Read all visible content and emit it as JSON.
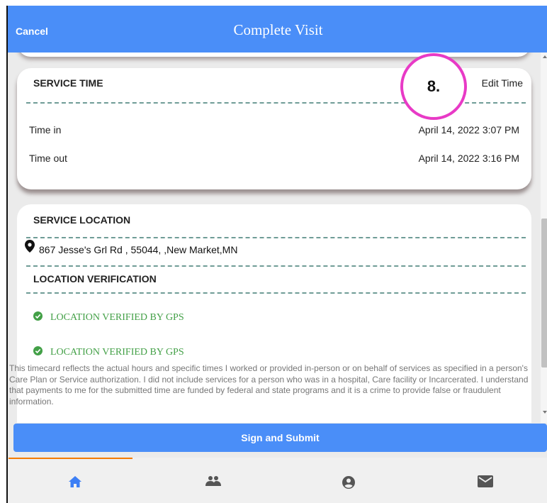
{
  "header": {
    "cancel_label": "Cancel",
    "title": "Complete Visit"
  },
  "service_time": {
    "title": "SERVICE TIME",
    "edit_label": "Edit Time",
    "time_in_label": "Time in",
    "time_in_value": "April 14, 2022 3:07 PM",
    "time_out_label": "Time out",
    "time_out_value": "April 14, 2022 3:16 PM"
  },
  "service_location": {
    "title": "SERVICE LOCATION",
    "address": "867 Jesse's Grl Rd , 55044, ,New Market,MN",
    "icon": "map-pin-icon"
  },
  "location_verification": {
    "title": "LOCATION VERIFICATION",
    "items": [
      "LOCATION VERIFIED BY GPS",
      "LOCATION VERIFIED BY GPS"
    ],
    "icon": "check-circle-icon",
    "color": "#43a047"
  },
  "disclaimer": "This timecard reflects the actual hours and specific times I worked or provided in-person or on behalf of services as specified in a person's Care Plan or Service authorization. I did not include services for a person who was in a hospital, Care facility or Incarcerated. I understand that payments to me for the submitted time are funded by federal and state programs and it is a crime to provide false or fraudulent information.",
  "submit_label": "Sign and Submit",
  "nav": {
    "items": [
      {
        "icon": "home-icon",
        "active": true
      },
      {
        "icon": "people-icon",
        "active": false
      },
      {
        "icon": "account-icon",
        "active": false
      },
      {
        "icon": "mail-icon",
        "active": false
      }
    ],
    "active_color": "#3d7ff5",
    "indicator_color": "#f57c00"
  },
  "annotation": {
    "label": "8.",
    "color": "#e83ac6"
  },
  "colors": {
    "accent": "#4a8ef8",
    "dash": "#6f9c96",
    "verified": "#43a047"
  }
}
